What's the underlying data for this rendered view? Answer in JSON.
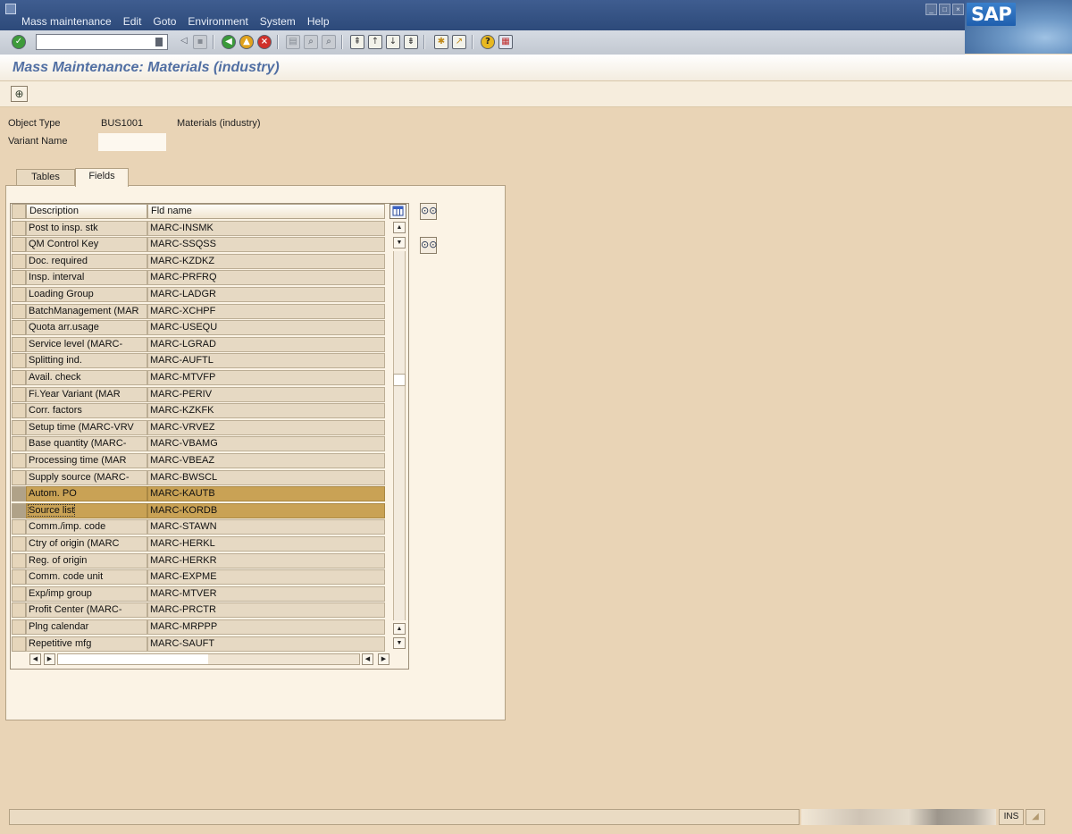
{
  "menu": {
    "items": [
      "Mass maintenance",
      "Edit",
      "Goto",
      "Environment",
      "System",
      "Help"
    ]
  },
  "window_buttons": [
    "minimize",
    "maximize",
    "close"
  ],
  "brand": {
    "logo_text": "SAP",
    "color": "#1f5fae"
  },
  "toolbar": {
    "command_field_value": "",
    "icons": [
      "enter-icon",
      "command-field-dropdown-icon",
      "back-arrow-icon",
      "save-icon",
      "back-icon",
      "exit-icon",
      "cancel-icon",
      "print-icon",
      "find-icon",
      "find-next-icon",
      "first-page-icon",
      "previous-page-icon",
      "next-page-icon",
      "last-page-icon",
      "create-session-icon",
      "shortcut-icon",
      "help-icon",
      "customize-layout-icon"
    ]
  },
  "title": {
    "text": "Mass Maintenance: Materials (industry)",
    "color": "#516fa3"
  },
  "app_toolbar": {
    "execute_icon": "execute-icon"
  },
  "header": {
    "object_type_label": "Object Type",
    "object_type_value": "BUS1001",
    "object_type_desc": "Materials (industry)",
    "variant_name_label": "Variant Name",
    "variant_name_value": ""
  },
  "tabs": [
    {
      "label": "Tables",
      "active": false
    },
    {
      "label": "Fields",
      "active": true
    }
  ],
  "table": {
    "columns": [
      "Description",
      "Fld name"
    ],
    "selected_color": "#c9a255",
    "rows": [
      {
        "desc": "Post to insp. stk",
        "fld": "MARC-INSMK",
        "selected": false
      },
      {
        "desc": "QM Control Key",
        "fld": "MARC-SSQSS",
        "selected": false
      },
      {
        "desc": "Doc. required",
        "fld": "MARC-KZDKZ",
        "selected": false
      },
      {
        "desc": "Insp. interval",
        "fld": "MARC-PRFRQ",
        "selected": false
      },
      {
        "desc": "Loading Group",
        "fld": "MARC-LADGR",
        "selected": false
      },
      {
        "desc": "BatchManagement (MAR",
        "fld": "MARC-XCHPF",
        "selected": false
      },
      {
        "desc": "Quota arr.usage",
        "fld": "MARC-USEQU",
        "selected": false
      },
      {
        "desc": "Service level (MARC-",
        "fld": "MARC-LGRAD",
        "selected": false
      },
      {
        "desc": "Splitting ind.",
        "fld": "MARC-AUFTL",
        "selected": false
      },
      {
        "desc": "Avail. check",
        "fld": "MARC-MTVFP",
        "selected": false
      },
      {
        "desc": "Fi.Year Variant (MAR",
        "fld": "MARC-PERIV",
        "selected": false
      },
      {
        "desc": "Corr. factors",
        "fld": "MARC-KZKFK",
        "selected": false
      },
      {
        "desc": "Setup time (MARC-VRV",
        "fld": "MARC-VRVEZ",
        "selected": false
      },
      {
        "desc": "Base quantity (MARC-",
        "fld": "MARC-VBAMG",
        "selected": false
      },
      {
        "desc": "Processing time (MAR",
        "fld": "MARC-VBEAZ",
        "selected": false
      },
      {
        "desc": "Supply source (MARC-",
        "fld": "MARC-BWSCL",
        "selected": false
      },
      {
        "desc": "Autom. PO",
        "fld": "MARC-KAUTB",
        "selected": true
      },
      {
        "desc": "Source list",
        "fld": "MARC-KORDB",
        "selected": true
      },
      {
        "desc": "Comm./imp. code",
        "fld": "MARC-STAWN",
        "selected": false
      },
      {
        "desc": "Ctry of origin (MARC",
        "fld": "MARC-HERKL",
        "selected": false
      },
      {
        "desc": "Reg. of origin",
        "fld": "MARC-HERKR",
        "selected": false
      },
      {
        "desc": "Comm. code unit",
        "fld": "MARC-EXPME",
        "selected": false
      },
      {
        "desc": "Exp/imp group",
        "fld": "MARC-MTVER",
        "selected": false
      },
      {
        "desc": "Profit Center (MARC-",
        "fld": "MARC-PRCTR",
        "selected": false
      },
      {
        "desc": "Plng calendar",
        "fld": "MARC-MRPPP",
        "selected": false
      },
      {
        "desc": "Repetitive mfg",
        "fld": "MARC-SAUFT",
        "selected": false
      }
    ]
  },
  "status": {
    "message": "",
    "mode": "INS"
  }
}
